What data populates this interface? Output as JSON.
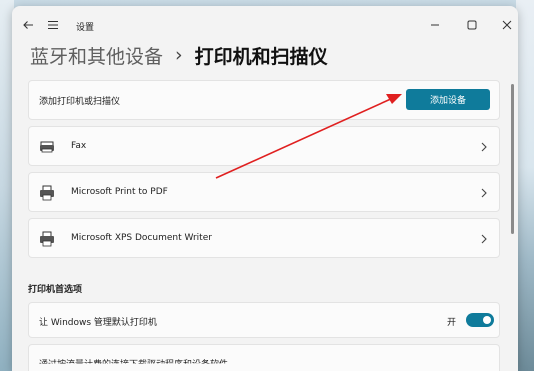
{
  "titlebar": {
    "app_title": "设置"
  },
  "breadcrumb": {
    "parent": "蓝牙和其他设备",
    "separator": "›",
    "current": "打印机和扫描仪"
  },
  "add_device": {
    "label": "添加打印机或扫描仪",
    "button": "添加设备"
  },
  "printers": [
    {
      "name": "Fax",
      "icon": "fax-icon"
    },
    {
      "name": "Microsoft Print to PDF",
      "icon": "printer-icon"
    },
    {
      "name": "Microsoft XPS Document Writer",
      "icon": "printer-icon"
    }
  ],
  "preferences": {
    "title": "打印机首选项",
    "default_label": "让 Windows 管理默认打印机",
    "toggle_state": "开",
    "toggle_on": true,
    "next_label": "通过按流量计费的连接下载驱动程序和设备软件"
  },
  "colors": {
    "accent": "#0f7b9b",
    "annotation": "#e02020"
  }
}
